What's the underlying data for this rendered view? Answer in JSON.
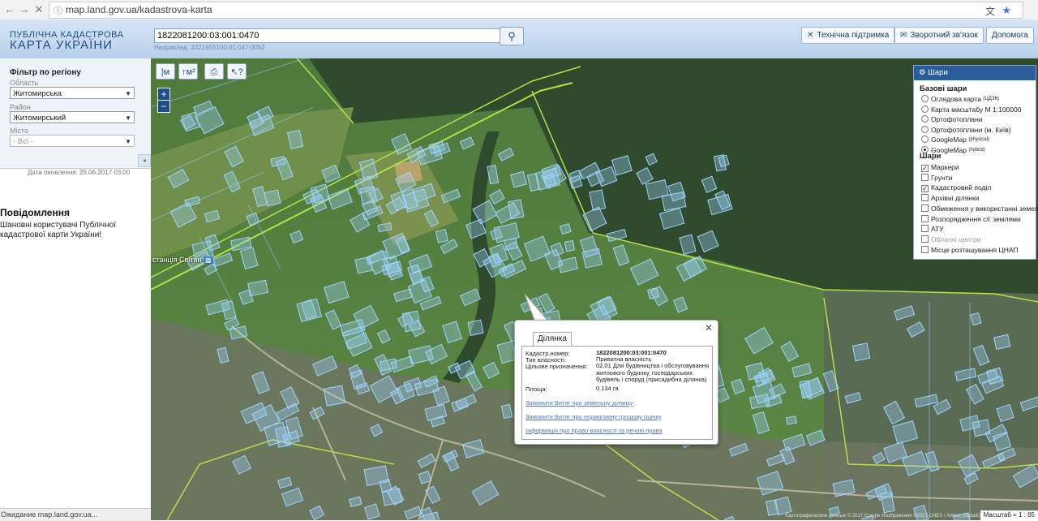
{
  "browser": {
    "url": "map.land.gov.ua/kadastrova-karta",
    "status": "Ожидание map.land.gov.ua..."
  },
  "header": {
    "logo_line1": "ПУБЛІЧНА КАДАСТРОВА",
    "logo_line2": "КАРТА УКРАЇНИ",
    "search_value": "1822081200:03:001:0470",
    "search_example": "Наприклад: 3221655100:01:047:0052",
    "buttons": {
      "support": "Технічна підтримка",
      "feedback": "Зворотний зв'язок",
      "help": "Допомога"
    }
  },
  "filter": {
    "title": "Фільтр по регіону",
    "oblast_label": "Область",
    "oblast_value": "Житомирська",
    "rayon_label": "Район",
    "rayon_value": "Житомирський",
    "city_label": "Місто",
    "city_value": "- Всі -"
  },
  "updated": "Дата оновлення: 25.06.2017 03:00",
  "notice": {
    "title": "Повідомлення",
    "text": "Шановні користувачі Публічної кадастрової карти України!"
  },
  "map": {
    "tools": {
      "measure_length": "|м",
      "measure_area": "↑м²",
      "print": "⎙",
      "info": "↖?"
    },
    "zoom_in": "+",
    "zoom_out": "−",
    "station_label": "станція Світин",
    "scale_text": "Масштаб = 1 : 85",
    "attribution": "Картографические данные © 2017 Google  Изображения ©2017 CNES / Airbus, DigitalGlobe"
  },
  "layers": {
    "title": "Шари",
    "base_title": "Базові шари",
    "base": [
      {
        "label": "Оглядова карта",
        "sup": "(ЦДЗК)",
        "checked": false
      },
      {
        "label": "Карта масштабу М 1:100000",
        "sup": "",
        "checked": false
      },
      {
        "label": "Ортофотоплани",
        "sup": "",
        "checked": false
      },
      {
        "label": "Ортофотоплани (м. Київ)",
        "sup": "",
        "checked": false
      },
      {
        "label": "GoogleMap",
        "sup": "(physical)",
        "checked": false
      },
      {
        "label": "GoogleMap",
        "sup": "(hybrid)",
        "checked": true
      }
    ],
    "overlay_title": "Шари",
    "overlays": [
      {
        "label": "Маркери",
        "checked": true,
        "disabled": false
      },
      {
        "label": "Грунти",
        "checked": false,
        "disabled": false
      },
      {
        "label": "Кадастровий поділ",
        "checked": true,
        "disabled": false
      },
      {
        "label": "Архівні ділянки",
        "checked": false,
        "disabled": false
      },
      {
        "label": "Обмеження у використанні земель",
        "checked": false,
        "disabled": false
      },
      {
        "label": "Розпорядження с/г землями",
        "checked": false,
        "disabled": false
      },
      {
        "label": "АТУ",
        "checked": false,
        "disabled": false
      },
      {
        "label": "Обласні центри",
        "checked": false,
        "disabled": true
      },
      {
        "label": "Місце розташування ЦНАП",
        "checked": false,
        "disabled": false
      }
    ]
  },
  "popup": {
    "tab": "Ділянка",
    "k1": "Кадастр.номер:",
    "v1": "1822081200:03:001:0470",
    "k2": "Тип власності:",
    "v2": "Приватна власність",
    "k3": "Цільове призначення:",
    "v3": "02.01 Для будівництва і обслуговування житлового будинку, господарських будівель і споруд (присадибна ділянка)",
    "k4": "Площа:",
    "v4": "0.134 га",
    "link1": "Замовити Витяг про земельну ділянку",
    "link2": "Замовити Витяг про нормативну грошову оцінку",
    "link3": "Інформація про право власності та речові права"
  },
  "colors": {
    "header_bg": "#c7dbf1",
    "brand": "#1c4e8a",
    "parcel": "#9fd3ff",
    "boundary": "#b5e04a",
    "forest": "#2f4a2c"
  }
}
